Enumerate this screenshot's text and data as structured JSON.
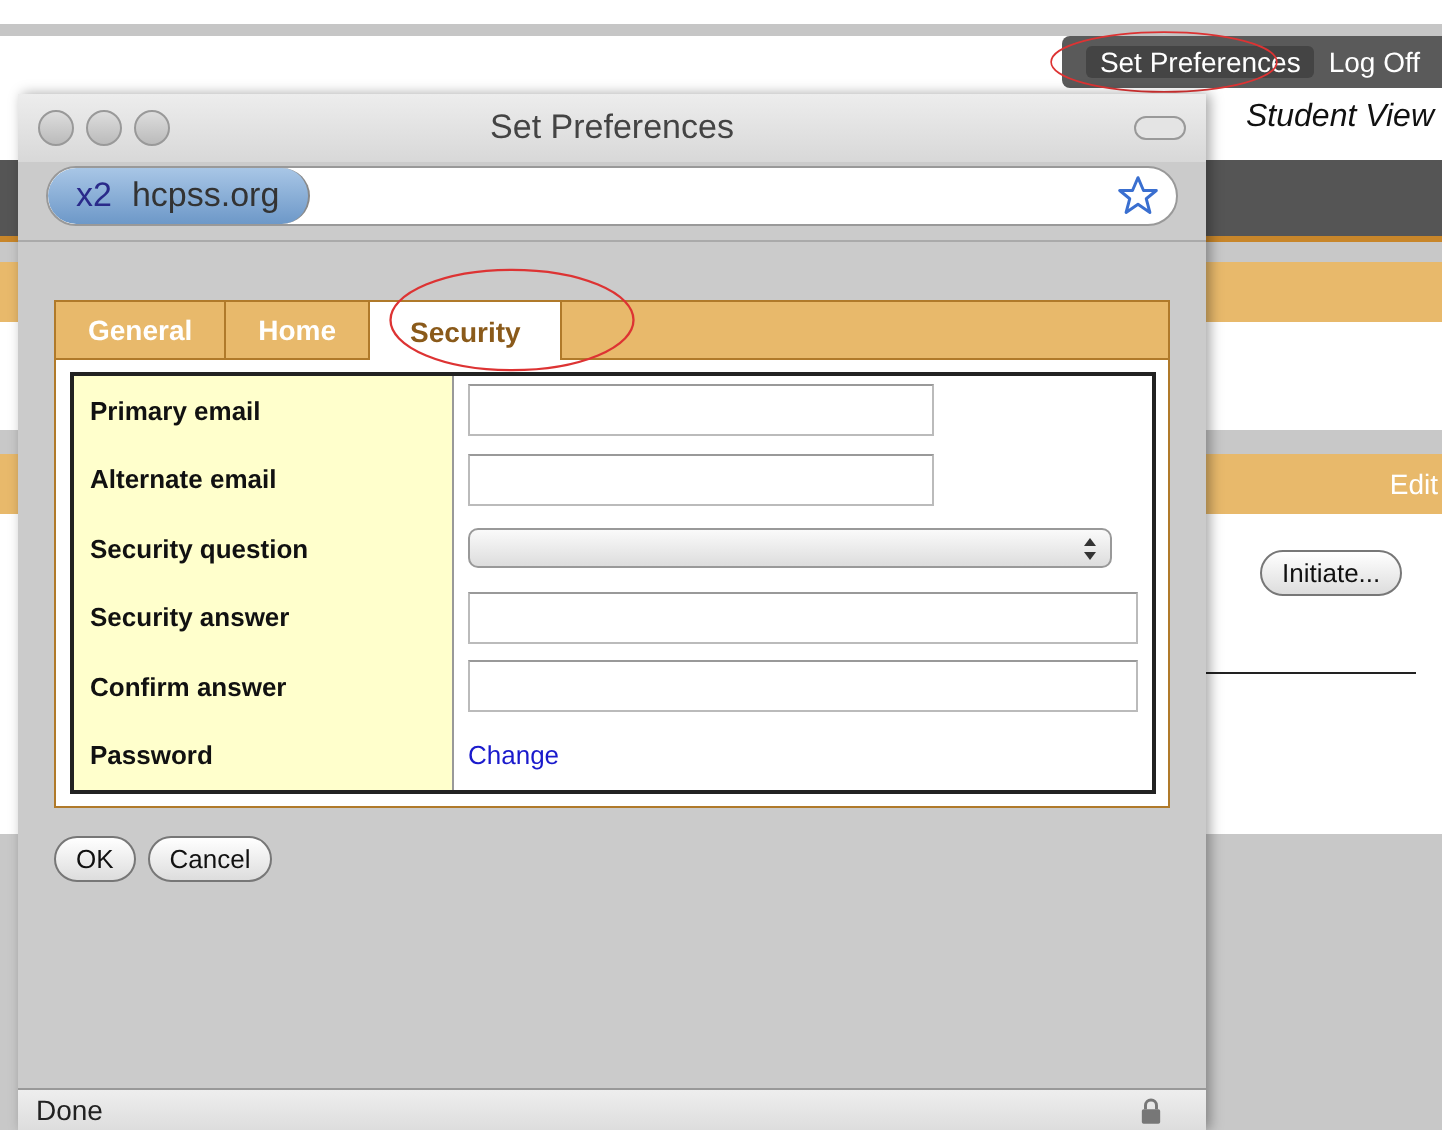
{
  "page": {
    "nav_links": [
      {
        "label": "Set Preferences",
        "selected": true
      },
      {
        "label": "Log Off",
        "selected": false
      }
    ],
    "view_label": "Student View",
    "edit_label": "Edit",
    "initiate_button": "Initiate..."
  },
  "window": {
    "title": "Set Preferences",
    "site_badge": "x2",
    "address": "hcpss.org",
    "tabs": [
      {
        "label": "General",
        "selected": false
      },
      {
        "label": "Home",
        "selected": false
      },
      {
        "label": "Security",
        "selected": true
      }
    ],
    "fields": [
      {
        "label": "Primary email",
        "kind": "short"
      },
      {
        "label": "Alternate email",
        "kind": "short"
      },
      {
        "label": "Security question",
        "kind": "select"
      },
      {
        "label": "Security answer",
        "kind": "long"
      },
      {
        "label": "Confirm answer",
        "kind": "long"
      },
      {
        "label": "Password",
        "kind": "link",
        "link": "Change"
      }
    ],
    "buttons": [
      "OK",
      "Cancel"
    ],
    "status_bar": "Done"
  }
}
